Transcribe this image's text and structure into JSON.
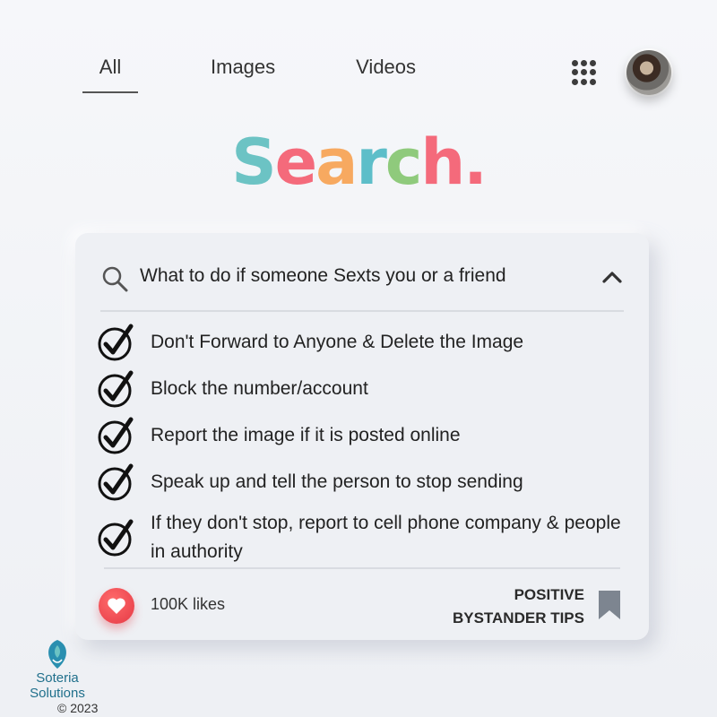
{
  "tabs": {
    "all": "All",
    "images": "Images",
    "videos": "Videos"
  },
  "icons": {
    "apps": "grid-apps-icon",
    "search": "search-icon",
    "collapse": "chevron-up-icon",
    "check": "checkmark-circle-icon",
    "like": "heart-icon",
    "save": "bookmark-icon"
  },
  "logo": {
    "letters": [
      "S",
      "e",
      "a",
      "r",
      "c",
      "h",
      "."
    ],
    "colors": [
      "#6cc3c4",
      "#f46a7b",
      "#f7a960",
      "#5dbec9",
      "#8fca7c",
      "#f46a7b",
      "#f46a7b"
    ]
  },
  "search": {
    "query": "What to do if someone Sexts you or a friend"
  },
  "tips": [
    "Don't Forward to Anyone & Delete the Image",
    "Block the number/account",
    "Report the image if it is posted online",
    "Speak up and tell the person to stop sending",
    "If they don't stop, report to cell phone company & people in authority"
  ],
  "footer": {
    "likes": "100K  likes",
    "heading_line1": "POSITIVE",
    "heading_line2": "BYSTANDER TIPS"
  },
  "brand": {
    "name_line1": "Soteria",
    "name_line2": "Solutions",
    "copyright": "© 2023"
  },
  "colors": {
    "heart": "#e53945",
    "brand": "#1f6f8b",
    "card": "#eef0f4"
  }
}
